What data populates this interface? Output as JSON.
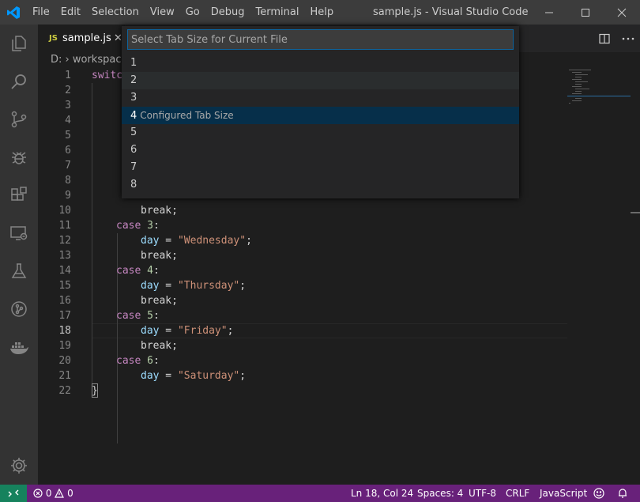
{
  "window": {
    "title": "sample.js - Visual Studio Code",
    "menu": [
      "File",
      "Edit",
      "Selection",
      "View",
      "Go",
      "Debug",
      "Terminal",
      "Help"
    ]
  },
  "tab": {
    "icon_text": "JS",
    "name": "sample.js",
    "close": "✕"
  },
  "breadcrumb": {
    "root": "D:",
    "folder": "workspace"
  },
  "quick_pick": {
    "placeholder": "Select Tab Size for Current File",
    "items": [
      {
        "label": "1",
        "desc": ""
      },
      {
        "label": "2",
        "desc": ""
      },
      {
        "label": "3",
        "desc": ""
      },
      {
        "label": "4",
        "desc": "Configured Tab Size"
      },
      {
        "label": "5",
        "desc": ""
      },
      {
        "label": "6",
        "desc": ""
      },
      {
        "label": "7",
        "desc": ""
      },
      {
        "label": "8",
        "desc": ""
      }
    ],
    "selected_index": 3
  },
  "code": {
    "line_numbers": [
      "1",
      "2",
      "3",
      "4",
      "5",
      "6",
      "7",
      "8",
      "9",
      "10",
      "11",
      "12",
      "13",
      "14",
      "15",
      "16",
      "17",
      "18",
      "19",
      "20",
      "21",
      "22"
    ],
    "visible": {
      "l1": "switc",
      "l10_break": "break;",
      "l11_case": "case",
      "l11_num": "3",
      "l11_colon": ":",
      "l12_var": "day",
      "l12_eq": " = ",
      "l12_str": "\"Wednesday\"",
      "l12_semi": ";",
      "l13_break": "break;",
      "l14_case": "case",
      "l14_num": "4",
      "l14_colon": ":",
      "l15_var": "day",
      "l15_eq": " = ",
      "l15_str": "\"Thursday\"",
      "l15_semi": ";",
      "l16_break": "break;",
      "l17_case": "case",
      "l17_num": "5",
      "l17_colon": ":",
      "l18_var": "day",
      "l18_eq": " = ",
      "l18_str": "\"Friday\"",
      "l18_semi": ";",
      "l19_break": "break;",
      "l20_case": "case",
      "l20_num": "6",
      "l20_colon": ":",
      "l21_var": "day",
      "l21_eq": " = ",
      "l21_str": "\"Saturday\"",
      "l21_semi": ";",
      "l22_brace": "}"
    }
  },
  "status": {
    "problems_errors": "0",
    "problems_warnings": "0",
    "position": "Ln 18, Col 24",
    "indent": "Spaces: 4",
    "encoding": "UTF-8",
    "eol": "CRLF",
    "language": "JavaScript"
  },
  "colors": {
    "statusbar": "#68217a",
    "remote": "#16825d",
    "selection": "#062f4a",
    "accent": "#0e639c"
  },
  "icons": [
    "vscode-logo-icon",
    "explorer-icon",
    "search-icon",
    "source-control-icon",
    "debug-icon",
    "extensions-icon",
    "remote-explorer-icon",
    "testing-icon",
    "git-graph-icon",
    "docker-icon",
    "settings-gear-icon",
    "split-editor-icon",
    "more-actions-icon",
    "remote-icon",
    "error-icon",
    "warning-icon",
    "feedback-icon",
    "bell-icon"
  ]
}
